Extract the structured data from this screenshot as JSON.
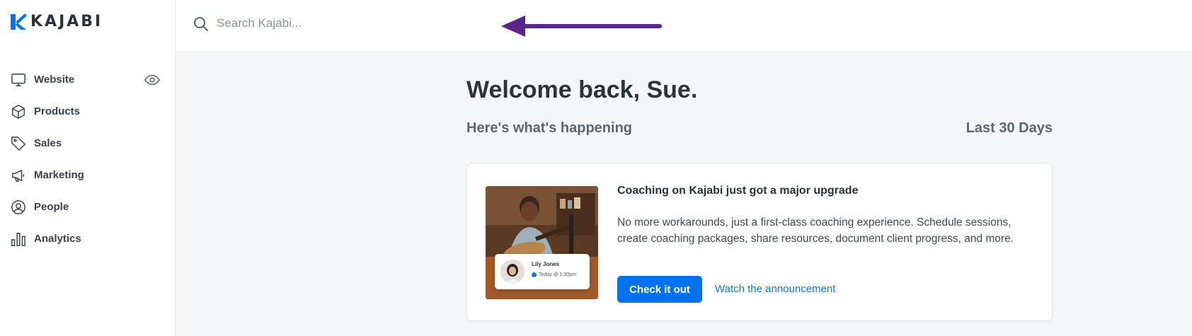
{
  "app": {
    "logo_text": "KAJABI",
    "brand_color": "#0072ef"
  },
  "search": {
    "placeholder": "Search Kajabi..."
  },
  "sidebar": {
    "items": [
      {
        "label": "Website",
        "icon": "monitor-icon"
      },
      {
        "label": "Products",
        "icon": "box-icon"
      },
      {
        "label": "Sales",
        "icon": "tag-icon"
      },
      {
        "label": "Marketing",
        "icon": "megaphone-icon"
      },
      {
        "label": "People",
        "icon": "user-circle-icon"
      },
      {
        "label": "Analytics",
        "icon": "bar-chart-icon"
      }
    ],
    "website_preview_icon": "eye-icon"
  },
  "main": {
    "welcome": "Welcome back, Sue.",
    "subtitle": "Here's what's happening",
    "range": "Last 30 Days"
  },
  "announcement": {
    "title": "Coaching on Kajabi just got a major upgrade",
    "body": "No more workarounds, just a first-class coaching experience. Schedule sessions, create coaching packages, share resources, document client progress, and more.",
    "primary_label": "Check it out",
    "link_label": "Watch the announcement",
    "image": {
      "contact_name": "Lily Jones",
      "contact_time": "Today @ 1:30pm"
    }
  },
  "annotation": {
    "arrow_color": "#5b2589"
  }
}
